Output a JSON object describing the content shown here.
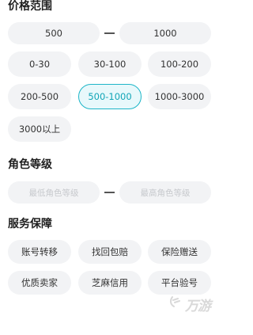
{
  "price_range": {
    "title": "价格范围",
    "min_value": "500",
    "max_value": "1000",
    "options": [
      "0-30",
      "30-100",
      "100-200",
      "200-500",
      "500-1000",
      "1000-3000",
      "3000以上"
    ],
    "selected": "500-1000"
  },
  "role_level": {
    "title": "角色等级",
    "min_placeholder": "最低角色等级",
    "max_placeholder": "最高角色等级"
  },
  "service": {
    "title": "服务保障",
    "options": [
      "账号转移",
      "找回包赔",
      "保险赠送",
      "优质卖家",
      "芝麻信用",
      "平台验号"
    ]
  },
  "watermark": {
    "text": "万游"
  },
  "colors": {
    "accent": "#1eb6c8",
    "pill_bg": "#f2f3f5",
    "placeholder": "#c7c9cd"
  }
}
